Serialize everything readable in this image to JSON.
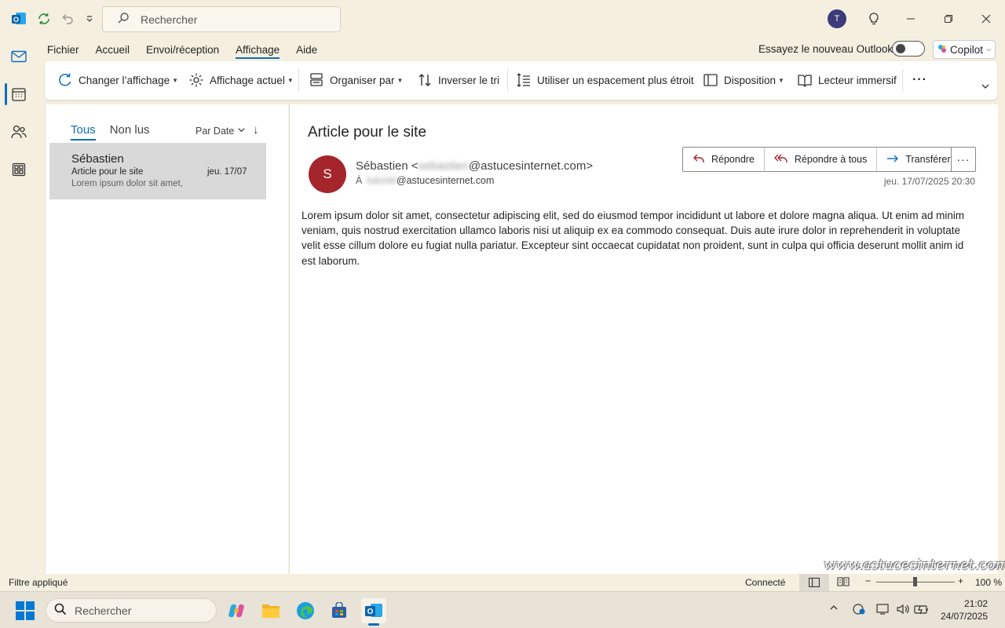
{
  "titlebar": {
    "search_placeholder": "Rechercher",
    "avatar_initial": "T"
  },
  "menu": {
    "items": [
      "Fichier",
      "Accueil",
      "Envoi/réception",
      "Affichage",
      "Aide"
    ],
    "active": "Affichage",
    "try_new_label": "Essayez le nouveau Outlook",
    "copilot_label": "Copilot"
  },
  "ribbon": {
    "change_view": "Changer l’affichage",
    "current_view": "Affichage actuel",
    "arrange_by": "Organiser par",
    "reverse_sort": "Inverser le tri",
    "tighter_spacing": "Utiliser un espacement plus étroit",
    "layout": "Disposition",
    "immersive_reader": "Lecteur immersif",
    "more": "···"
  },
  "list": {
    "tab_all": "Tous",
    "tab_unread": "Non lus",
    "sort_label": "Par Date",
    "sort_direction_icon": "↓",
    "items": [
      {
        "sender": "Sébastien",
        "subject": "Article pour le site",
        "date": "jeu. 17/07",
        "preview": "Lorem ipsum dolor sit amet,"
      }
    ]
  },
  "reading": {
    "subject": "Article pour le site",
    "sender_initial": "S",
    "from_name": "Sébastien <",
    "from_user_blurred": "sebastien",
    "from_domain": "@astucesinternet.com>",
    "to_label": "À",
    "to_user_blurred": "tutoriel",
    "to_domain": "@astucesinternet.com",
    "reply": "Répondre",
    "reply_all": "Répondre à tous",
    "forward": "Transférer",
    "more": "···",
    "date": "jeu. 17/07/2025 20:30",
    "body": "Lorem ipsum dolor sit amet, consectetur adipiscing elit, sed do eiusmod tempor incididunt ut labore et dolore magna aliqua. Ut enim ad minim veniam, quis nostrud exercitation ullamco laboris nisi ut aliquip ex ea commodo consequat. Duis aute irure dolor in reprehenderit in voluptate velit esse cillum dolore eu fugiat nulla pariatur. Excepteur sint occaecat cupidatat non proident, sunt in culpa qui officia deserunt mollit anim id est laborum."
  },
  "watermark": "www.astucesinternet.com",
  "status": {
    "filter": "Filtre appliqué",
    "connection": "Connecté",
    "zoom": "100 %",
    "zoom_minus": "−",
    "zoom_plus": "+"
  },
  "taskbar": {
    "search_placeholder": "Rechercher",
    "time": "21:02",
    "date": "24/07/2025"
  },
  "colors": {
    "accent": "#0f6cbd",
    "sender_avatar": "#a4262c",
    "user_avatar": "#3b3a7a",
    "background": "#f4efdf"
  }
}
